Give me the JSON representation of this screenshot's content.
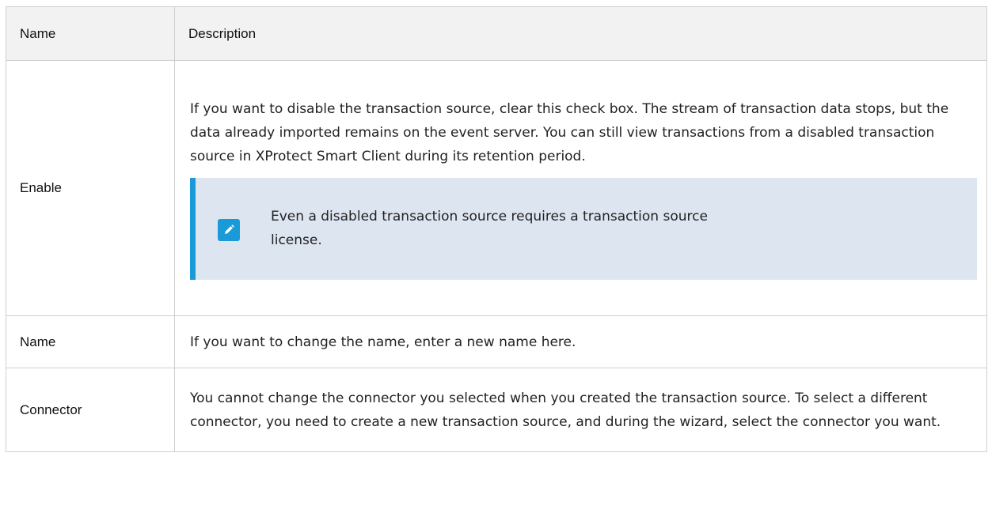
{
  "table": {
    "headers": {
      "name": "Name",
      "description": "Description"
    },
    "rows": {
      "enable": {
        "name": "Enable",
        "description": "If you want to disable the transaction source, clear this check box. The stream of transaction data stops, but the data already imported remains on the event server. You can still view transactions from a disabled transaction source in XProtect Smart Client during its retention period.",
        "note": {
          "icon": "pencil-icon",
          "text": "Even a disabled transaction source requires a transaction source license."
        }
      },
      "name": {
        "name": "Name",
        "description": "If you want to change the name, enter a new name here."
      },
      "connector": {
        "name": "Connector",
        "description": "You cannot change the connector you selected when you created the transaction source. To select a different connector, you need to create a new transaction source, and during the wizard, select the connector you want."
      }
    }
  },
  "colors": {
    "note_background": "#dde5f1",
    "note_accent": "#1a9bd7",
    "header_background": "#f2f2f2"
  }
}
